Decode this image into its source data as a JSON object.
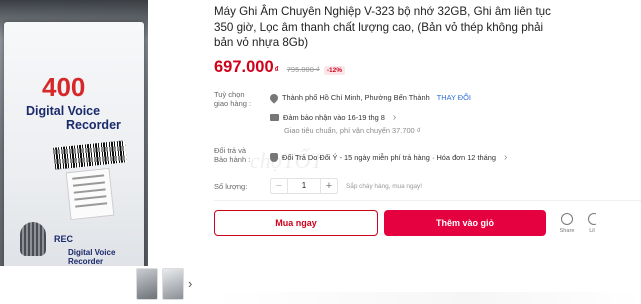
{
  "gallery": {
    "box_number": "400",
    "box_title_line1": "Digital Voice",
    "box_title_line2": "Recorder",
    "rec_label": "REC",
    "rec_sub_line1": "Digital Voice",
    "rec_sub_line2": "Recorder",
    "next_icon": "›"
  },
  "product": {
    "title": "Máy Ghi Âm Chuyên Nghiệp V-323 bộ nhớ 32GB, Ghi âm liên tục 350 giờ, Lọc âm thanh chất lượng cao, (Bản vỏ thép không phải bản vỏ nhựa 8Gb)",
    "price": "697.000",
    "currency": "₫",
    "old_price": "795.000 ₫",
    "discount": "-12%"
  },
  "shipping": {
    "label_line1": "Tuỳ chọn",
    "label_line2": "giao hàng :",
    "location": "Thành phố Hồ Chí Minh, Phường Bến Thành",
    "change_label": "THAY ĐỔI",
    "guarantee": "Đảm bảo nhận vào 16-19 thg 8",
    "standard": "Giao tiêu chuẩn, phí vận chuyển 37.700 ₫"
  },
  "returns": {
    "label_line1": "Đổi trả và",
    "label_line2": "Bảo hành :",
    "policy": "Đổi Trả Do Đổi Ý - 15 ngày miễn phí trả hàng · Hóa đơn 12 tháng"
  },
  "quantity": {
    "label": "Số lượng:",
    "minus": "−",
    "value": "1",
    "plus": "+",
    "stock_note": "Sắp cháy hàng, mua ngay!"
  },
  "actions": {
    "buy_now": "Mua ngay",
    "add_to_cart": "Thêm vào giỏ",
    "share": "Share",
    "more_partial": "Lil"
  },
  "watermark": "chợTỐT",
  "colors": {
    "accent": "#e5003f",
    "price": "#d0021b",
    "link": "#2d6fd8"
  }
}
